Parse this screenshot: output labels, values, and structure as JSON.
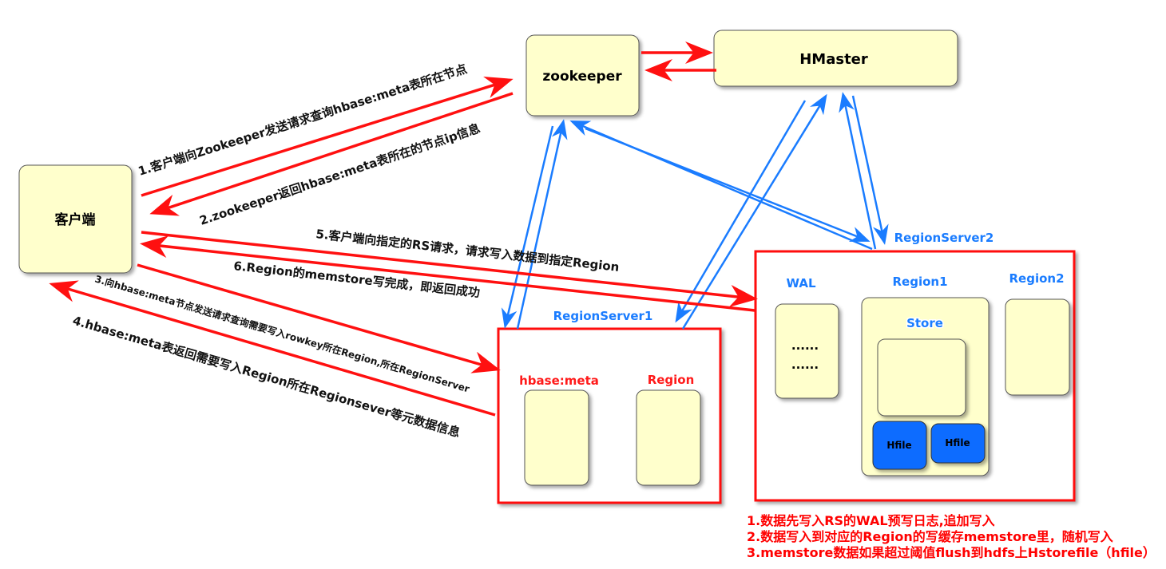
{
  "nodes": {
    "client": "客户端",
    "zookeeper": "zookeeper",
    "hmaster": "HMaster",
    "regionserver1": "RegionServer1",
    "regionserver2": "RegionServer2",
    "hbase_meta": "hbase:meta",
    "region": "Region",
    "wal": "WAL",
    "wal_dots": [
      "......",
      "......"
    ],
    "region1": "Region1",
    "region2": "Region2",
    "store": "Store",
    "hfiles": [
      "Hfile",
      "Hfile"
    ]
  },
  "steps": {
    "s1": "1.客户端向Zookeeper发送请求查询hbase:meta表所在节点",
    "s2": "2.zookeeper返回hbase:meta表所在的节点ip信息",
    "s3": "3.向hbase:meta节点发送请求查询需要写入rowkey所在Region,所在RegionServer",
    "s4": "4.hbase:meta表返回需要写入Region所在Regionsever等元数据信息",
    "s5": "5.客户端向指定的RS请求，请求写入数据到指定Region",
    "s6": "6.Region的memstore写完成，即返回成功"
  },
  "notes": [
    "1.数据先写入RS的WAL预写日志,追加写入",
    "2.数据写入到对应的Region的写缓存memstore里，随机写入",
    "3.memstore数据如果超过阈值flush到hdfs上Hstorefile（hfile）"
  ],
  "colors": {
    "request_arrow": "#ff1010",
    "internal_arrow": "#1a7cff",
    "node_fill": "#ffffcc",
    "hfile_fill": "#0a6cff"
  }
}
